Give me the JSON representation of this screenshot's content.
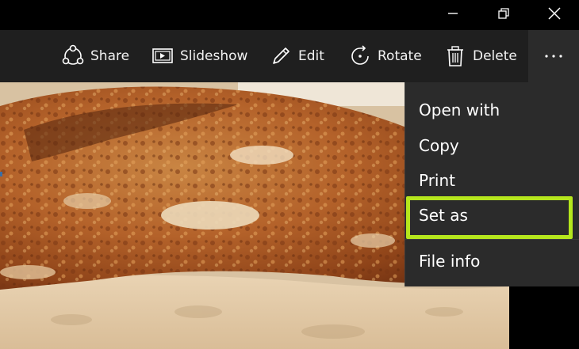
{
  "window": {
    "minimize_icon": "minimize-icon",
    "maximize_icon": "restore-icon",
    "close_icon": "close-icon"
  },
  "toolbar": {
    "share_label": "Share",
    "slideshow_label": "Slideshow",
    "edit_label": "Edit",
    "rotate_label": "Rotate",
    "delete_label": "Delete",
    "more_icon": "more-icon"
  },
  "context_menu": {
    "items": [
      {
        "label": "Open with"
      },
      {
        "label": "Copy"
      },
      {
        "label": "Print"
      },
      {
        "label": "Set as"
      },
      {
        "label": "File info"
      }
    ],
    "highlighted_item": "Set as",
    "highlight_color": "#b5e61d"
  },
  "colors": {
    "toolbar_bg": "#1f1f1f",
    "menu_bg": "#2b2b2b",
    "titlebar_bg": "#000000"
  }
}
